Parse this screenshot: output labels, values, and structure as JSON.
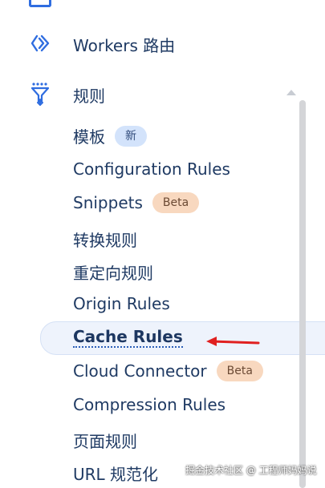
{
  "sidebar": {
    "workers_routes": {
      "label": "Workers 路由",
      "icon": "workers-chevrons-icon"
    },
    "rules": {
      "label": "规则",
      "icon": "funnel-icon",
      "expanded": true,
      "items": [
        {
          "label": "模板",
          "badge": "新"
        },
        {
          "label": "Configuration Rules"
        },
        {
          "label": "Snippets",
          "badge": "Beta"
        },
        {
          "label": "转换规则"
        },
        {
          "label": "重定向规则"
        },
        {
          "label": "Origin Rules"
        },
        {
          "label": "Cache Rules",
          "active": true
        },
        {
          "label": "Cloud Connector",
          "badge": "Beta"
        },
        {
          "label": "Compression Rules"
        },
        {
          "label": "页面规则"
        },
        {
          "label": "URL 规范化"
        }
      ]
    }
  },
  "annotation": {
    "arrow_color": "#e02020",
    "points_to": "Cache Rules"
  },
  "watermark": "掘金技术社区 @ 工程师妈妈说",
  "colors": {
    "text": "#1f3a63",
    "accent_blue": "#2f6de0",
    "badge_new_bg": "#d3e3fb",
    "badge_beta_bg": "#f8d8bf",
    "active_bg": "#eef3fc"
  }
}
